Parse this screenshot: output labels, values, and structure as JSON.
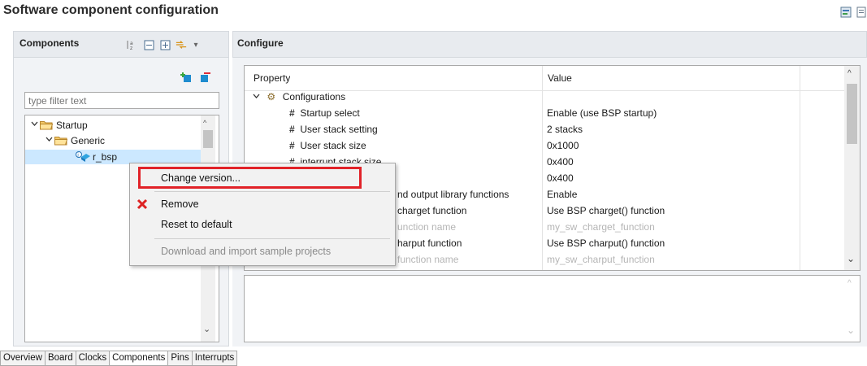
{
  "title": "Software component configuration",
  "components": {
    "title": "Components",
    "filter_placeholder": "type filter text",
    "tree": [
      {
        "label": "Startup"
      },
      {
        "label": "Generic"
      },
      {
        "label": "r_bsp"
      }
    ]
  },
  "configure": {
    "title": "Configure",
    "columns": [
      "Property",
      "Value"
    ],
    "rows": [
      {
        "name": "Configurations",
        "value": "",
        "enabled": true
      },
      {
        "name": "Startup select",
        "value": "Enable (use BSP startup)",
        "enabled": true
      },
      {
        "name": "User stack setting",
        "value": "2 stacks",
        "enabled": true
      },
      {
        "name": "User stack size",
        "value": "0x1000",
        "enabled": true
      },
      {
        "name": "interrupt stack size",
        "value": "0x400",
        "enabled": true
      },
      {
        "name": "",
        "value": "0x400",
        "enabled": true
      },
      {
        "name": "nd output library functions",
        "value": "Enable",
        "enabled": true
      },
      {
        "name": "charget function",
        "value": "Use BSP charget() function",
        "enabled": true
      },
      {
        "name": "unction name",
        "value": "my_sw_charget_function",
        "enabled": false
      },
      {
        "name": "harput function",
        "value": "Use BSP charput() function",
        "enabled": true
      },
      {
        "name": "function name",
        "value": "my_sw_charput_function",
        "enabled": false
      }
    ]
  },
  "context_menu": {
    "change_version": "Change version...",
    "remove": "Remove",
    "reset": "Reset to default",
    "download": "Download and import sample projects"
  },
  "tabs": [
    "Overview",
    "Board",
    "Clocks",
    "Components",
    "Pins",
    "Interrupts"
  ],
  "active_tab": "Components",
  "colors": {
    "highlight": "#e12228",
    "header": "#e8ebef",
    "selection": "#cce8ff"
  }
}
